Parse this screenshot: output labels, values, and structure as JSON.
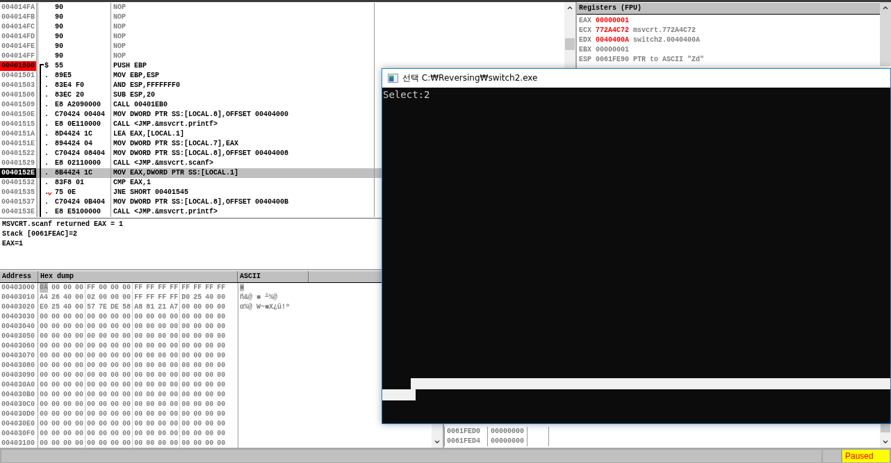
{
  "disassembly": {
    "rows": [
      {
        "address": "004014FA",
        "mark": "",
        "hex": "90",
        "code": "NOP",
        "dim": true,
        "breakpoint": false,
        "selected": false,
        "proc_start": false,
        "in_proc": false,
        "jump": false
      },
      {
        "address": "004014FB",
        "mark": "",
        "hex": "90",
        "code": "NOP",
        "dim": true,
        "breakpoint": false,
        "selected": false,
        "proc_start": false,
        "in_proc": false,
        "jump": false
      },
      {
        "address": "004014FC",
        "mark": "",
        "hex": "90",
        "code": "NOP",
        "dim": true,
        "breakpoint": false,
        "selected": false,
        "proc_start": false,
        "in_proc": false,
        "jump": false
      },
      {
        "address": "004014FD",
        "mark": "",
        "hex": "90",
        "code": "NOP",
        "dim": true,
        "breakpoint": false,
        "selected": false,
        "proc_start": false,
        "in_proc": false,
        "jump": false
      },
      {
        "address": "004014FE",
        "mark": "",
        "hex": "90",
        "code": "NOP",
        "dim": true,
        "breakpoint": false,
        "selected": false,
        "proc_start": false,
        "in_proc": false,
        "jump": false
      },
      {
        "address": "004014FF",
        "mark": "",
        "hex": "90",
        "code": "NOP",
        "dim": true,
        "breakpoint": false,
        "selected": false,
        "proc_start": false,
        "in_proc": false,
        "jump": false
      },
      {
        "address": "00401500",
        "mark": "$",
        "hex": "55",
        "code": "PUSH EBP",
        "dim": false,
        "breakpoint": true,
        "selected": false,
        "proc_start": true,
        "in_proc": true,
        "jump": false
      },
      {
        "address": "00401501",
        "mark": ".",
        "hex": "89E5",
        "code": "MOV EBP,ESP",
        "dim": false,
        "breakpoint": false,
        "selected": false,
        "proc_start": false,
        "in_proc": true,
        "jump": false
      },
      {
        "address": "00401503",
        "mark": ".",
        "hex": "83E4 F0",
        "code": "AND ESP,FFFFFFF0",
        "dim": false,
        "breakpoint": false,
        "selected": false,
        "proc_start": false,
        "in_proc": true,
        "jump": false
      },
      {
        "address": "00401506",
        "mark": ".",
        "hex": "83EC 20",
        "code": "SUB ESP,20",
        "dim": false,
        "breakpoint": false,
        "selected": false,
        "proc_start": false,
        "in_proc": true,
        "jump": false
      },
      {
        "address": "00401509",
        "mark": ".",
        "hex": "E8 A2090000",
        "code": "CALL 00401EB0",
        "dim": false,
        "breakpoint": false,
        "selected": false,
        "proc_start": false,
        "in_proc": true,
        "jump": false
      },
      {
        "address": "0040150E",
        "mark": ".",
        "hex": "C70424 00404",
        "code": "MOV DWORD PTR SS:[LOCAL.8],OFFSET 00404000",
        "dim": false,
        "breakpoint": false,
        "selected": false,
        "proc_start": false,
        "in_proc": true,
        "jump": false
      },
      {
        "address": "00401515",
        "mark": ".",
        "hex": "E8 0E110000",
        "code": "CALL <JMP.&msvcrt.printf>",
        "dim": false,
        "breakpoint": false,
        "selected": false,
        "proc_start": false,
        "in_proc": true,
        "jump": false
      },
      {
        "address": "0040151A",
        "mark": ".",
        "hex": "8D4424 1C",
        "code": "LEA EAX,[LOCAL.1]",
        "dim": false,
        "breakpoint": false,
        "selected": false,
        "proc_start": false,
        "in_proc": true,
        "jump": false
      },
      {
        "address": "0040151E",
        "mark": ".",
        "hex": "894424 04",
        "code": "MOV DWORD PTR SS:[LOCAL.7],EAX",
        "dim": false,
        "breakpoint": false,
        "selected": false,
        "proc_start": false,
        "in_proc": true,
        "jump": false
      },
      {
        "address": "00401522",
        "mark": ".",
        "hex": "C70424 08404",
        "code": "MOV DWORD PTR SS:[LOCAL.8],OFFSET 00404008",
        "dim": false,
        "breakpoint": false,
        "selected": false,
        "proc_start": false,
        "in_proc": true,
        "jump": false
      },
      {
        "address": "00401529",
        "mark": ".",
        "hex": "E8 02110000",
        "code": "CALL <JMP.&msvcrt.scanf>",
        "dim": false,
        "breakpoint": false,
        "selected": false,
        "proc_start": false,
        "in_proc": true,
        "jump": false
      },
      {
        "address": "0040152E",
        "mark": ".",
        "hex": "8B4424 1C",
        "code": "MOV EAX,DWORD PTR SS:[LOCAL.1]",
        "dim": false,
        "breakpoint": false,
        "selected": true,
        "proc_start": false,
        "in_proc": true,
        "jump": false
      },
      {
        "address": "00401532",
        "mark": ".",
        "hex": "83F8 01",
        "code": "CMP EAX,1",
        "dim": false,
        "breakpoint": false,
        "selected": false,
        "proc_start": false,
        "in_proc": true,
        "jump": false
      },
      {
        "address": "00401535",
        "mark": ".",
        "hex": "75 0E",
        "code": "JNE SHORT 00401545",
        "dim": false,
        "breakpoint": false,
        "selected": false,
        "proc_start": false,
        "in_proc": true,
        "jump": true
      },
      {
        "address": "00401537",
        "mark": ".",
        "hex": "C70424 0B404",
        "code": "MOV DWORD PTR SS:[LOCAL.8],OFFSET 0040400B",
        "dim": false,
        "breakpoint": false,
        "selected": false,
        "proc_start": false,
        "in_proc": true,
        "jump": false
      },
      {
        "address": "0040153E",
        "mark": ".",
        "hex": "E8 E5100000",
        "code": "CALL <JMP.&msvcrt.printf>",
        "dim": false,
        "breakpoint": false,
        "selected": false,
        "proc_start": false,
        "in_proc": true,
        "jump": false
      }
    ]
  },
  "registers": {
    "title": "Registers (FPU)",
    "rows": [
      {
        "name": "EAX",
        "value": "00000001",
        "changed": true,
        "comment": ""
      },
      {
        "name": "ECX",
        "value": "772A4C72",
        "changed": true,
        "comment": "msvcrt.772A4C72"
      },
      {
        "name": "EDX",
        "value": "0040400A",
        "changed": true,
        "comment": "switch2.0040400A"
      },
      {
        "name": "EBX",
        "value": "00000001",
        "changed": false,
        "comment": ""
      },
      {
        "name": "ESP",
        "value": "0061FE90",
        "changed": false,
        "comment": "PTR to ASCII \"Zd\""
      }
    ]
  },
  "info": [
    "MSVCRT.scanf returned EAX = 1",
    "Stack [0061FEAC]=2",
    "EAX=1"
  ],
  "dump": {
    "columns": [
      "Address",
      "Hex dump",
      "ASCII"
    ],
    "rows": [
      {
        "address": "00403000",
        "bytes": "0A 00 00 00 FF 00 00 00 FF FF FF FF FF FF FF FF",
        "ascii": "■",
        "selected": true
      },
      {
        "address": "00403010",
        "bytes": "A4 26 40 00 02 00 00 00 FF FF FF FF D0 25 40 00",
        "ascii": "ñ&@ ■        ╨%@",
        "selected": false
      },
      {
        "address": "00403020",
        "bytes": "E0 25 40 00 57 7E DE 58 A8 81 21 A7 00 00 00 00",
        "ascii": "α%@ W~■X¿ü!º",
        "selected": false
      },
      {
        "address": "00403030",
        "bytes": "00 00 00 00 00 00 00 00 00 00 00 00 00 00 00 00",
        "ascii": "",
        "selected": false
      },
      {
        "address": "00403040",
        "bytes": "00 00 00 00 00 00 00 00 00 00 00 00 00 00 00 00",
        "ascii": "",
        "selected": false
      },
      {
        "address": "00403050",
        "bytes": "00 00 00 00 00 00 00 00 00 00 00 00 00 00 00 00",
        "ascii": "",
        "selected": false
      },
      {
        "address": "00403060",
        "bytes": "00 00 00 00 00 00 00 00 00 00 00 00 00 00 00 00",
        "ascii": "",
        "selected": false
      },
      {
        "address": "00403070",
        "bytes": "00 00 00 00 00 00 00 00 00 00 00 00 00 00 00 00",
        "ascii": "",
        "selected": false
      },
      {
        "address": "00403080",
        "bytes": "00 00 00 00 00 00 00 00 00 00 00 00 00 00 00 00",
        "ascii": "",
        "selected": false
      },
      {
        "address": "00403090",
        "bytes": "00 00 00 00 00 00 00 00 00 00 00 00 00 00 00 00",
        "ascii": "",
        "selected": false
      },
      {
        "address": "004030A0",
        "bytes": "00 00 00 00 00 00 00 00 00 00 00 00 00 00 00 00",
        "ascii": "",
        "selected": false
      },
      {
        "address": "004030B0",
        "bytes": "00 00 00 00 00 00 00 00 00 00 00 00 00 00 00 00",
        "ascii": "",
        "selected": false
      },
      {
        "address": "004030C0",
        "bytes": "00 00 00 00 00 00 00 00 00 00 00 00 00 00 00 00",
        "ascii": "",
        "selected": false
      },
      {
        "address": "004030D0",
        "bytes": "00 00 00 00 00 00 00 00 00 00 00 00 00 00 00 00",
        "ascii": "",
        "selected": false
      },
      {
        "address": "004030E0",
        "bytes": "00 00 00 00 00 00 00 00 00 00 00 00 00 00 00 00",
        "ascii": "",
        "selected": false
      },
      {
        "address": "004030F0",
        "bytes": "00 00 00 00 00 00 00 00 00 00 00 00 00 00 00 00",
        "ascii": "",
        "selected": false
      },
      {
        "address": "00403100",
        "bytes": "00 00 00 00 00 00 00 00 00 00 00 00 00 00 00 00",
        "ascii": "",
        "selected": false
      }
    ]
  },
  "stack": {
    "rows": [
      {
        "address": "0061FED0",
        "value": "00000000"
      },
      {
        "address": "0061FED4",
        "value": "00000000"
      }
    ]
  },
  "console": {
    "title": "선택 C:₩Reversing₩switch2.exe",
    "text": "Select:2"
  },
  "status_bar": {
    "state": "Paused"
  }
}
